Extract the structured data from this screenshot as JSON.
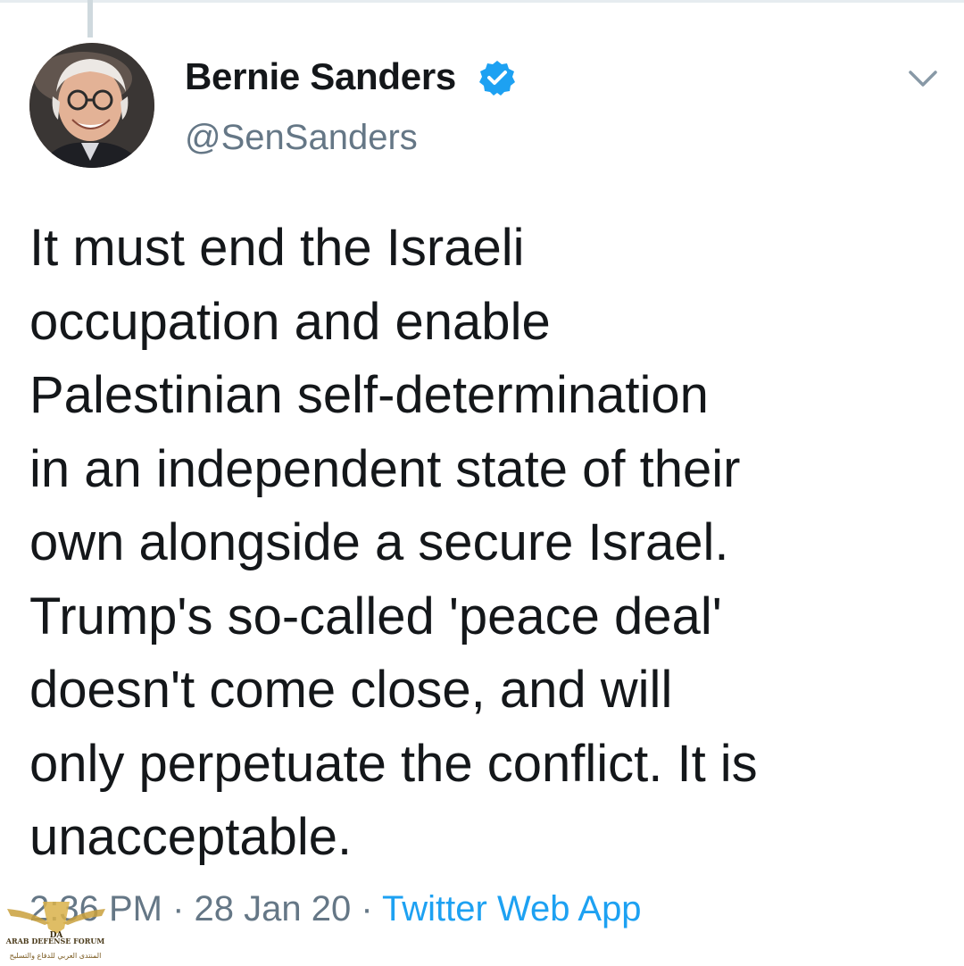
{
  "author": {
    "display_name": "Bernie Sanders",
    "handle": "@SenSanders",
    "verified": true,
    "avatar_icon": "profile-photo",
    "verified_icon": "verified-badge-icon"
  },
  "menu_icon": "chevron-down-icon",
  "tweet": {
    "text": "It must end the Israeli\noccupation and enable\nPalestinian self-determination\nin an independent state of their\nown alongside a secure Israel.\nTrump's so-called 'peace deal'\ndoesn't come close, and will\nonly perpetuate the conflict. It is\nunacceptable."
  },
  "meta": {
    "time": "2:36 PM",
    "separator": " · ",
    "date": "28 Jan 20",
    "source": "Twitter Web App"
  },
  "watermark": {
    "badge": "DA",
    "name": "ARAB DEFENSE FORUM",
    "subtitle": "المنتدى العربي للدفاع والتسليح"
  },
  "colors": {
    "text": "#14171a",
    "secondary": "#657786",
    "link": "#1da1f2",
    "verified": "#1da1f2"
  }
}
